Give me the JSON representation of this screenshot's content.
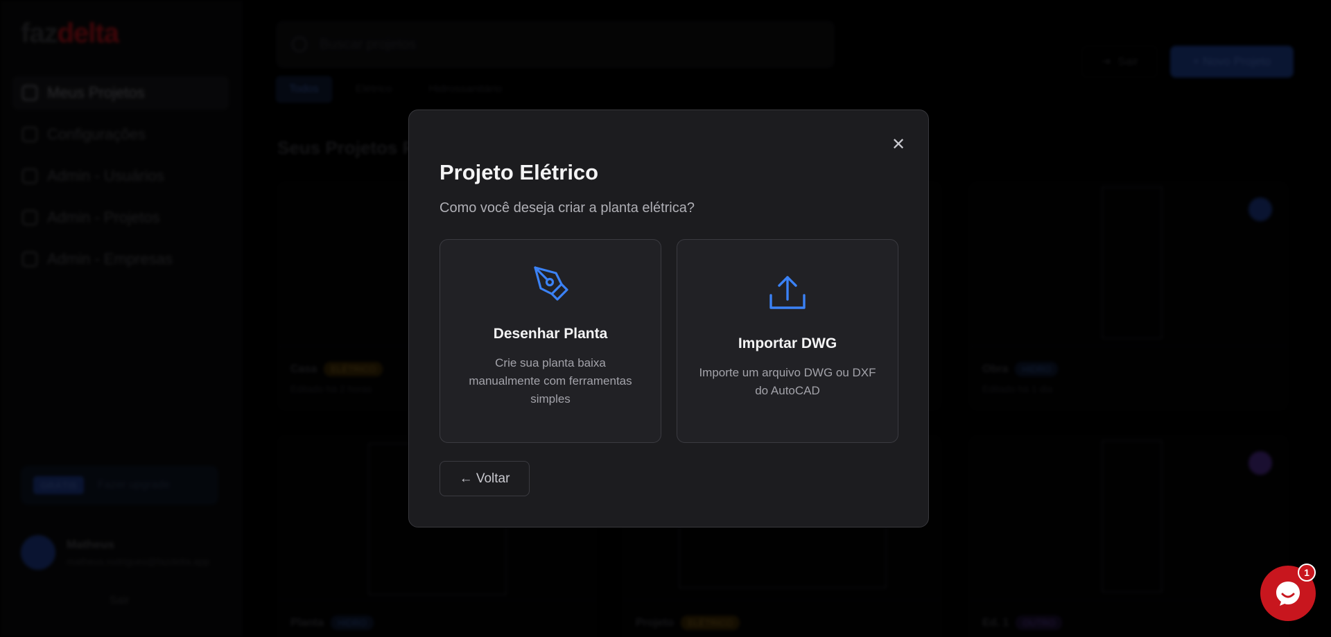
{
  "app": {
    "logo_part1": "faz",
    "logo_part2": "delta",
    "sidebar_items": [
      {
        "label": "Meus Projetos",
        "active": true
      },
      {
        "label": "Configurações",
        "active": false
      },
      {
        "label": "Admin - Usuários",
        "active": false
      },
      {
        "label": "Admin - Projetos",
        "active": false
      },
      {
        "label": "Admin - Empresas",
        "active": false
      }
    ],
    "plan_badge": "GRÁTIS",
    "plan_text": "Fazer upgrade",
    "user_name": "Matheus",
    "user_email": "matheus.rodrigues@fazdelta.app",
    "logout_label": "Sair",
    "search_placeholder": "Buscar projetos",
    "top_logout_label": "Sair",
    "new_project_label": "+ Novo Projeto",
    "tabs": [
      "Todos",
      "Elétrico",
      "Hidrossanitário"
    ],
    "section_title": "Seus Projetos Recentes",
    "cards": [
      {
        "name": "Casa",
        "badge": "ELÉTRICO",
        "date": "Editado há 2 horas"
      },
      {
        "name": "Obra",
        "badge": "HIDRO",
        "date": "Editado há 1 dia"
      },
      {
        "name": "Planta",
        "badge": "HIDRO",
        "date": ""
      },
      {
        "name": "Projeto",
        "badge": "ELÉTRICO",
        "date": ""
      },
      {
        "name": "Ed. 1",
        "badge": "OUTRO",
        "date": ""
      }
    ]
  },
  "modal": {
    "title": "Projeto Elétrico",
    "subtitle": "Como você deseja criar a planta elétrica?",
    "options": [
      {
        "title": "Desenhar Planta",
        "description": "Crie sua planta baixa manualmente com ferramentas simples",
        "icon": "pen-tool-icon"
      },
      {
        "title": "Importar DWG",
        "description": "Importe um arquivo DWG ou DXF do AutoCAD",
        "icon": "upload-icon"
      }
    ],
    "back_label": "← Voltar",
    "close_glyph": "✕"
  },
  "chat": {
    "badge_count": "1"
  },
  "colors": {
    "accent_blue": "#3b82f6",
    "brand_red": "#c8161e",
    "modal_bg": "#1c1c1f"
  }
}
